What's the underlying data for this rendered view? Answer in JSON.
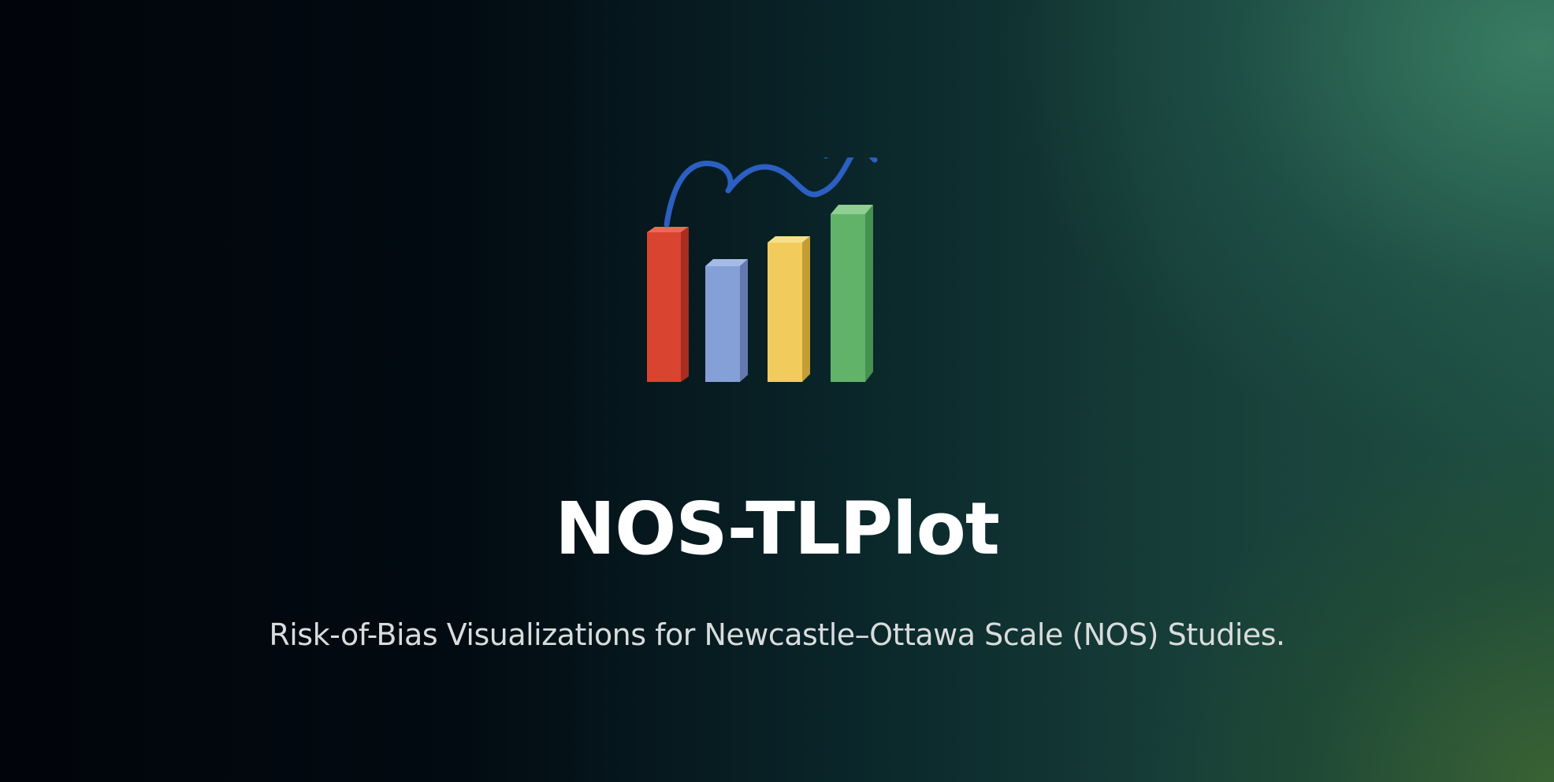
{
  "hero": {
    "logo_icon": "bar-chart-trend-icon",
    "title": "NOS-TLPlot",
    "subtitle": "Risk-of-Bias Visualizations for Newcastle–Ottawa Scale (NOS) Studies."
  },
  "colors": {
    "bar_red": "#d94430",
    "bar_blue": "#84a0d6",
    "bar_yellow": "#f1cc5c",
    "bar_green": "#62b36a",
    "trend_line": "#2c5fc2",
    "title": "#ffffff",
    "subtitle": "#d9dcdc"
  }
}
